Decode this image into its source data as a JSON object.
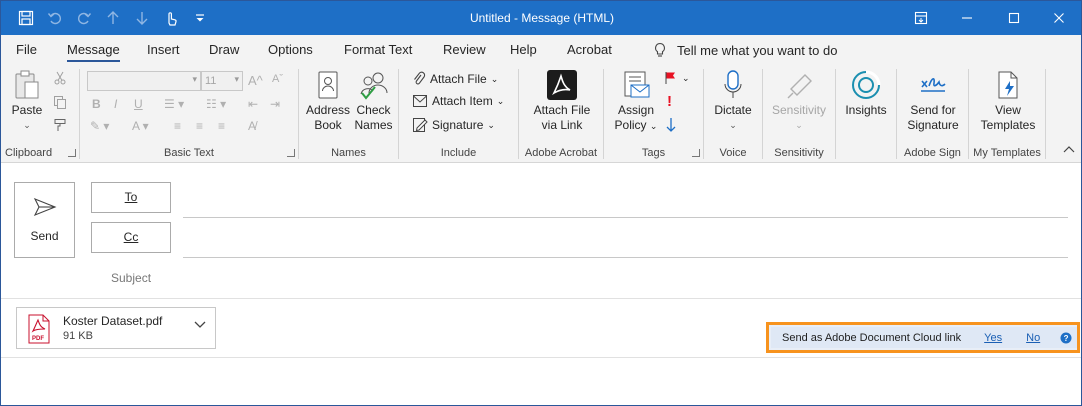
{
  "window": {
    "title": "Untitled  -  Message (HTML)"
  },
  "menu": {
    "tabs": [
      "File",
      "Message",
      "Insert",
      "Draw",
      "Options",
      "Format Text",
      "Review",
      "Help",
      "Acrobat"
    ],
    "active_tab": "Message",
    "tell_me": "Tell me what you want to do"
  },
  "ribbon": {
    "clipboard": {
      "label": "Clipboard",
      "paste": "Paste"
    },
    "basic_text": {
      "label": "Basic Text",
      "font_size": "11"
    },
    "names": {
      "label": "Names",
      "address_book_1": "Address",
      "address_book_2": "Book",
      "check_names_1": "Check",
      "check_names_2": "Names"
    },
    "include": {
      "label": "Include",
      "attach_file": "Attach File",
      "attach_item": "Attach Item",
      "signature": "Signature"
    },
    "adobe_acrobat": {
      "label": "Adobe Acrobat",
      "attach_link_1": "Attach File",
      "attach_link_2": "via Link"
    },
    "tags": {
      "label": "Tags",
      "assign_policy_1": "Assign",
      "assign_policy_2": "Policy"
    },
    "voice": {
      "label": "Voice",
      "dictate": "Dictate"
    },
    "sensitivity": {
      "label": "Sensitivity",
      "button": "Sensitivity"
    },
    "insights": {
      "button": "Insights"
    },
    "adobe_sign": {
      "label": "Adobe Sign",
      "send_1": "Send for",
      "send_2": "Signature"
    },
    "my_templates": {
      "label": "My Templates",
      "view_1": "View",
      "view_2": "Templates"
    }
  },
  "compose": {
    "send": "Send",
    "to": "To",
    "cc": "Cc",
    "subject": "Subject"
  },
  "attachment": {
    "name": "Koster Dataset.pdf",
    "size": "91 KB"
  },
  "infobar": {
    "text": "Send as Adobe Document Cloud link",
    "yes": "Yes",
    "no": "No"
  },
  "colors": {
    "titlebar": "#1e6fc6",
    "accent": "#2b579a",
    "highlight": "#f7931e",
    "adobe_red": "#d0021b"
  }
}
